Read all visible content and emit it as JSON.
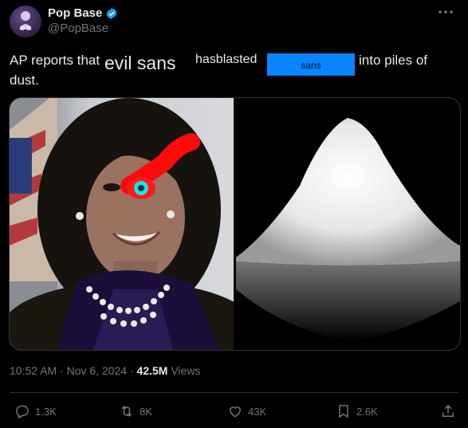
{
  "post": {
    "author_name": "Pop Base",
    "author_handle": "@PopBase",
    "text_prefix": "AP reports that",
    "text_highlight": "evil sans",
    "text_middle": "hasblasted",
    "redacted_label": "sans",
    "text_suffix": "into piles of",
    "text_line2": "dust.",
    "timestamp": "10:52 AM · Nov 6, 2024 · ",
    "views_count": "42.5M",
    "views_label": " Views"
  },
  "actions": {
    "reply_count": "1.3K",
    "repost_count": "8K",
    "like_count": "43K",
    "bookmark_count": "2.6K"
  },
  "icons": {
    "avatar": "pop-base-logo-icon",
    "verified": "verified-badge-icon",
    "more": "more-options-icon",
    "reply": "reply-icon",
    "repost": "repost-icon",
    "like": "heart-icon",
    "bookmark": "bookmark-icon",
    "share": "share-icon"
  },
  "colors": {
    "background": "#000000",
    "text": "#e7e9ea",
    "muted": "#71767b",
    "verified": "#1d9bf0",
    "redaction_box": "#0a84ff"
  }
}
